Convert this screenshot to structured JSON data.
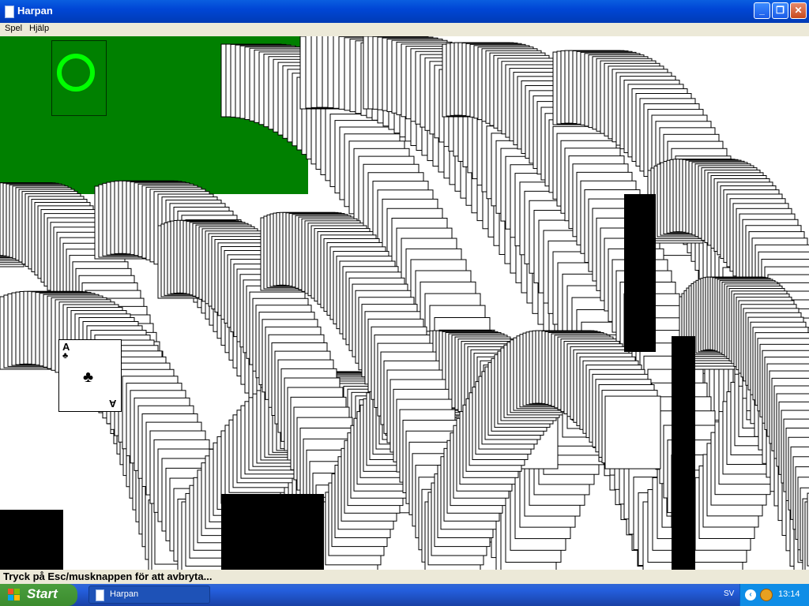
{
  "window": {
    "title": "Harpan",
    "minimize_glyph": "_",
    "maximize_glyph": "❐",
    "close_glyph": "✕"
  },
  "menu": {
    "items": [
      "Spel",
      "Hjälp"
    ]
  },
  "game": {
    "stock_icon": "green-circle-icon",
    "ace_card": {
      "rank": "A",
      "suit": "♣"
    }
  },
  "status": {
    "text": "Tryck på Esc/musknappen för att avbryta..."
  },
  "taskbar": {
    "start_label": "Start",
    "task_label": "Harpan",
    "language": "SV",
    "clock": "13:14"
  },
  "colors": {
    "felt": "#008000",
    "stock_ring": "#00ff00",
    "title_bar": "#0046d5",
    "start_button": "#3c8c2e",
    "tray": "#0f8de6",
    "red_suit": "#ff0000"
  }
}
